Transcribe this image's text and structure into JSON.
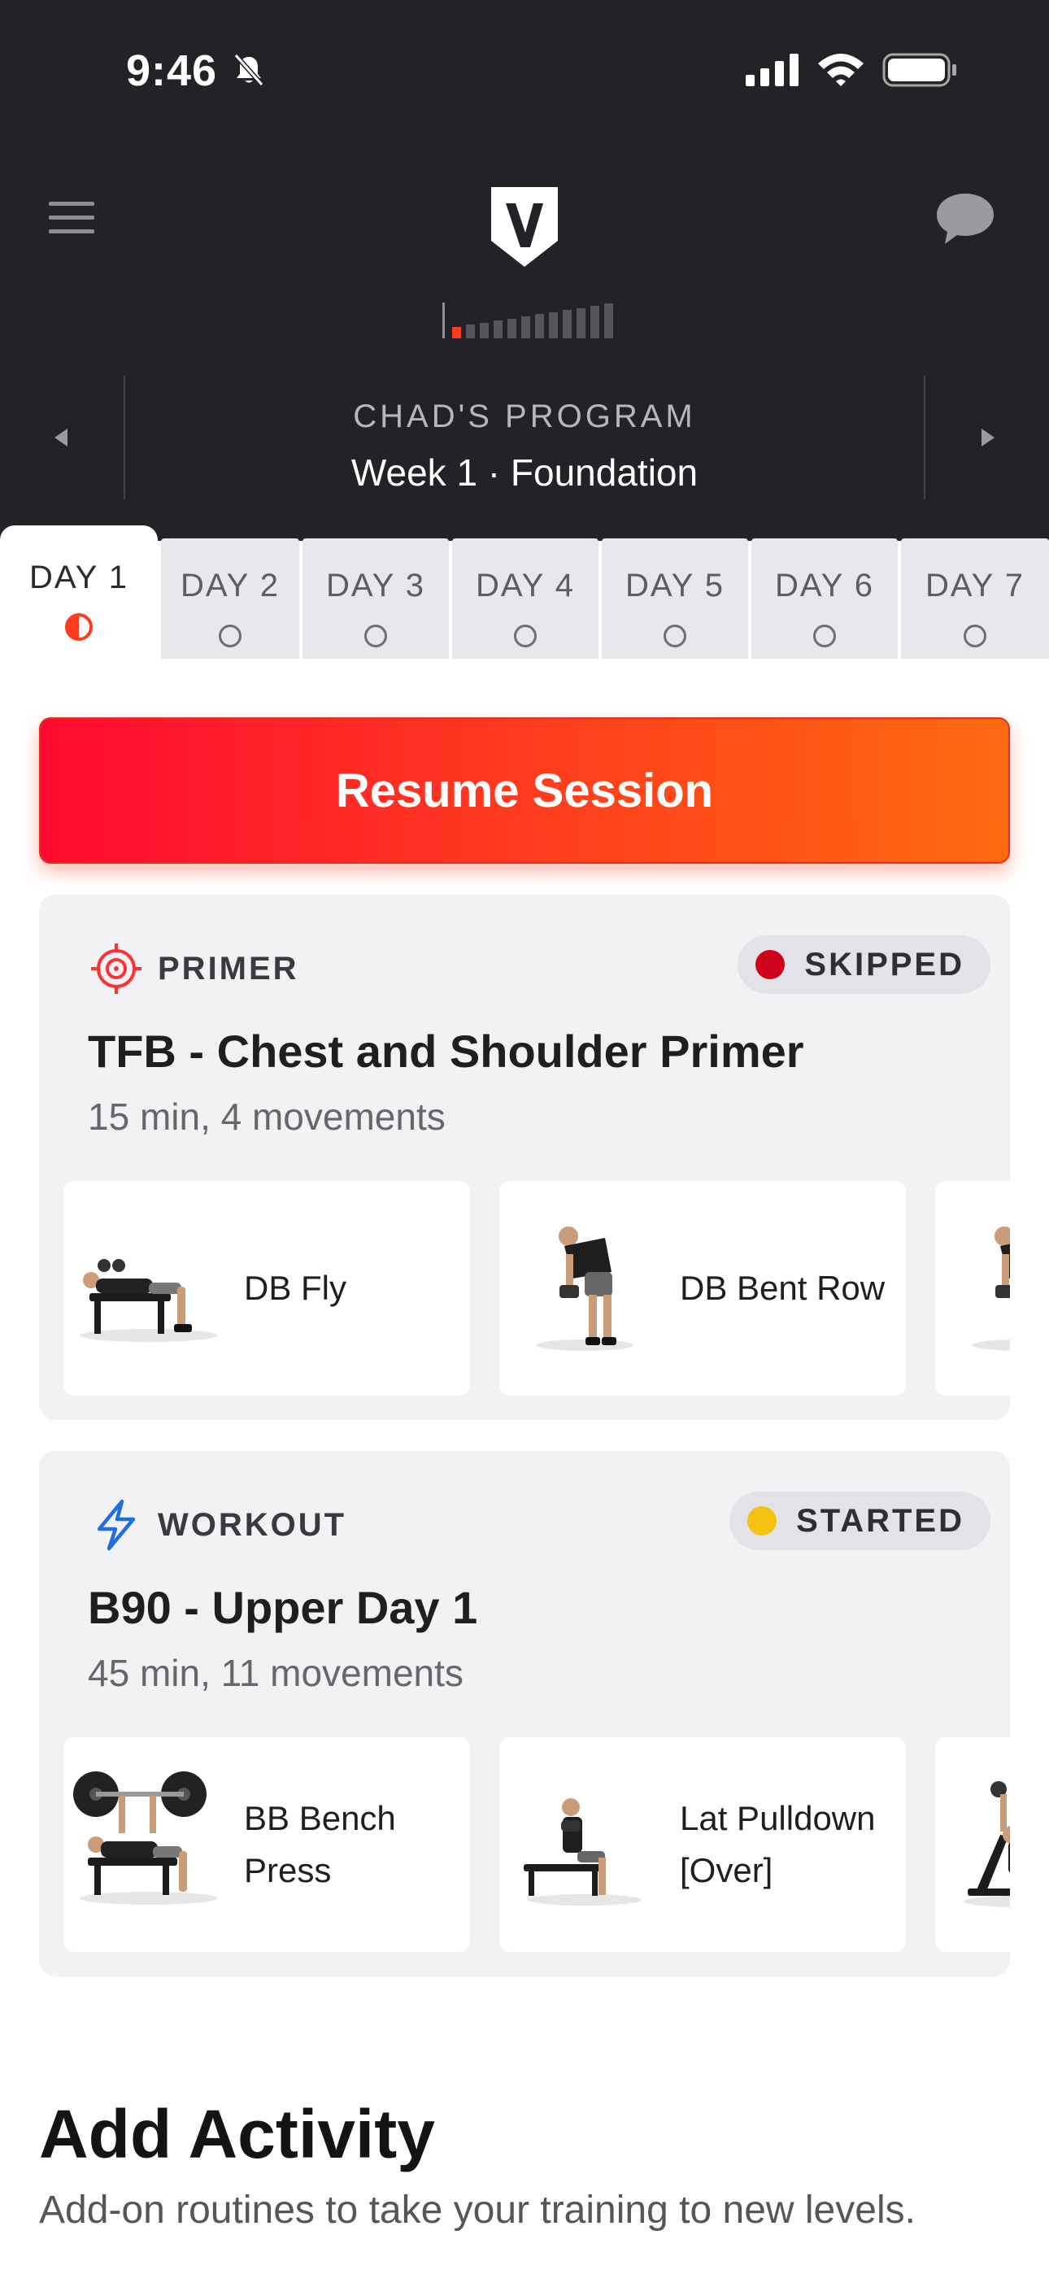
{
  "status_bar": {
    "time": "9:46",
    "icons": [
      "bell-slash-icon",
      "cellular-signal-icon",
      "wifi-icon",
      "battery-icon"
    ]
  },
  "header": {
    "menu_icon": "hamburger-menu-icon",
    "logo_icon": "brand-logo-icon",
    "chat_icon": "chat-bubble-icon",
    "program_progress": {
      "total_weeks": 12,
      "current_week": 1
    },
    "program_label": "CHAD'S  PROGRAM",
    "week_label": "Week 1 · Foundation"
  },
  "tabs": [
    {
      "label": "DAY 1",
      "active": true,
      "status": "half"
    },
    {
      "label": "DAY 2",
      "active": false,
      "status": "empty"
    },
    {
      "label": "DAY 3",
      "active": false,
      "status": "empty"
    },
    {
      "label": "DAY 4",
      "active": false,
      "status": "empty"
    },
    {
      "label": "DAY 5",
      "active": false,
      "status": "empty"
    },
    {
      "label": "DAY 6",
      "active": false,
      "status": "empty"
    },
    {
      "label": "DAY 7",
      "active": false,
      "status": "empty"
    }
  ],
  "resume_button": {
    "label": "Resume Session"
  },
  "sessions": [
    {
      "type": "PRIMER",
      "icon": "target-icon",
      "status": "SKIPPED",
      "status_color": "#d0021b",
      "title": "TFB - Chest and Shoulder Primer",
      "subtitle": "15 min, 4 movements",
      "movements": [
        {
          "name": "DB Fly",
          "image": "db-fly-image"
        },
        {
          "name": "DB Bent Row",
          "image": "db-bent-row-image"
        },
        {
          "name": "",
          "image": "movement-image"
        }
      ]
    },
    {
      "type": "WORKOUT",
      "icon": "lightning-bolt-icon",
      "status": "STARTED",
      "status_color": "#f5c211",
      "title": "B90 - Upper Day 1",
      "subtitle": "45 min, 11 movements",
      "movements": [
        {
          "name": "BB Bench Press",
          "image": "bb-bench-press-image"
        },
        {
          "name": "Lat Pulldown [Over]",
          "image": "lat-pulldown-image"
        },
        {
          "name": "",
          "image": "movement-image"
        }
      ]
    }
  ],
  "add_activity": {
    "title": "Add Activity",
    "subtitle": "Add-on routines to take your training to new levels."
  },
  "colors": {
    "header_bg": "#232327",
    "accent_red": "#ff2a2a",
    "accent_orange": "#ff6a10",
    "card_bg": "#f2f2f5",
    "workout_icon": "#1f6fe0"
  }
}
